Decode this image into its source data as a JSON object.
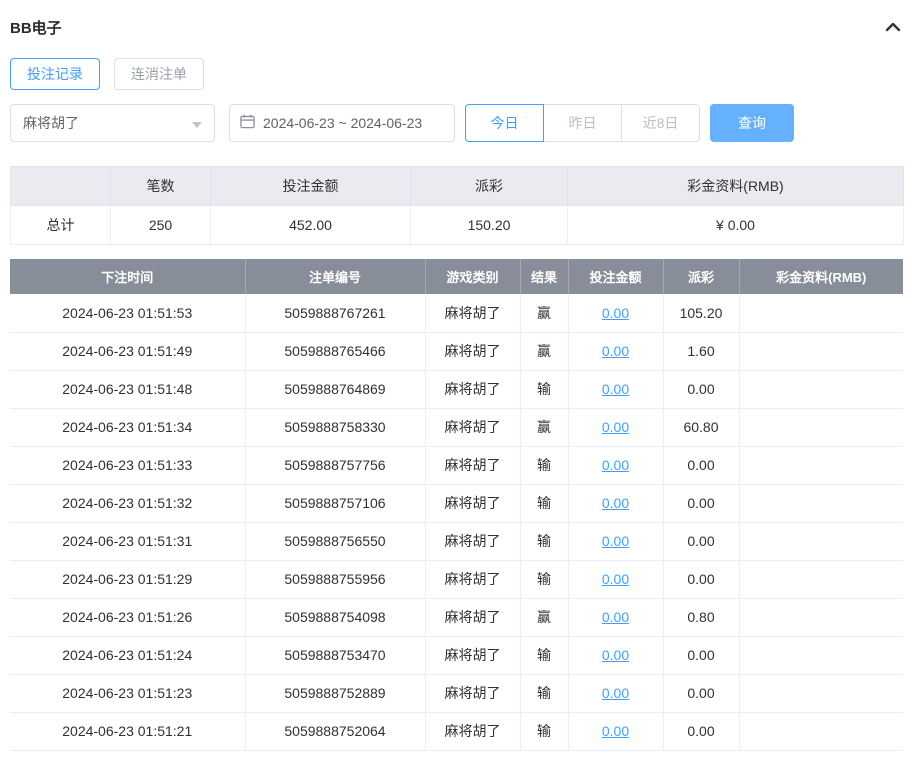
{
  "header": {
    "title": "BB电子"
  },
  "tabs": [
    {
      "label": "投注记录",
      "active": true
    },
    {
      "label": "连消注单",
      "active": false
    }
  ],
  "filters": {
    "game_select_value": "麻将胡了",
    "date_range_value": "2024-06-23 ~ 2024-06-23",
    "quick_buttons": [
      {
        "label": "今日",
        "active": true
      },
      {
        "label": "昨日",
        "active": false
      },
      {
        "label": "近8日",
        "active": false
      }
    ],
    "search_label": "查询"
  },
  "summary": {
    "headers": [
      "",
      "笔数",
      "投注金额",
      "派彩",
      "彩金资料(RMB)"
    ],
    "row": {
      "label": "总计",
      "count": "250",
      "bet": "452.00",
      "payout": "150.20",
      "bonus": "¥ 0.00"
    }
  },
  "table": {
    "headers": [
      "下注时间",
      "注单编号",
      "游戏类别",
      "结果",
      "投注金额",
      "派彩",
      "彩金资料(RMB)"
    ],
    "rows": [
      {
        "time": "2024-06-23 01:51:53",
        "id": "5059888767261",
        "game": "麻将胡了",
        "result": "赢",
        "bet": "0.00",
        "payout": "105.20",
        "bonus": ""
      },
      {
        "time": "2024-06-23 01:51:49",
        "id": "5059888765466",
        "game": "麻将胡了",
        "result": "赢",
        "bet": "0.00",
        "payout": "1.60",
        "bonus": ""
      },
      {
        "time": "2024-06-23 01:51:48",
        "id": "5059888764869",
        "game": "麻将胡了",
        "result": "输",
        "bet": "0.00",
        "payout": "0.00",
        "bonus": ""
      },
      {
        "time": "2024-06-23 01:51:34",
        "id": "5059888758330",
        "game": "麻将胡了",
        "result": "赢",
        "bet": "0.00",
        "payout": "60.80",
        "bonus": ""
      },
      {
        "time": "2024-06-23 01:51:33",
        "id": "5059888757756",
        "game": "麻将胡了",
        "result": "输",
        "bet": "0.00",
        "payout": "0.00",
        "bonus": ""
      },
      {
        "time": "2024-06-23 01:51:32",
        "id": "5059888757106",
        "game": "麻将胡了",
        "result": "输",
        "bet": "0.00",
        "payout": "0.00",
        "bonus": ""
      },
      {
        "time": "2024-06-23 01:51:31",
        "id": "5059888756550",
        "game": "麻将胡了",
        "result": "输",
        "bet": "0.00",
        "payout": "0.00",
        "bonus": ""
      },
      {
        "time": "2024-06-23 01:51:29",
        "id": "5059888755956",
        "game": "麻将胡了",
        "result": "输",
        "bet": "0.00",
        "payout": "0.00",
        "bonus": ""
      },
      {
        "time": "2024-06-23 01:51:26",
        "id": "5059888754098",
        "game": "麻将胡了",
        "result": "赢",
        "bet": "0.00",
        "payout": "0.80",
        "bonus": ""
      },
      {
        "time": "2024-06-23 01:51:24",
        "id": "5059888753470",
        "game": "麻将胡了",
        "result": "输",
        "bet": "0.00",
        "payout": "0.00",
        "bonus": ""
      },
      {
        "time": "2024-06-23 01:51:23",
        "id": "5059888752889",
        "game": "麻将胡了",
        "result": "输",
        "bet": "0.00",
        "payout": "0.00",
        "bonus": ""
      },
      {
        "time": "2024-06-23 01:51:21",
        "id": "5059888752064",
        "game": "麻将胡了",
        "result": "输",
        "bet": "0.00",
        "payout": "0.00",
        "bonus": ""
      }
    ]
  },
  "colors": {
    "accent": "#409eff",
    "search-btn": "#66b1ff",
    "table-header-bg": "#878d99",
    "summary-header-bg": "#e9ebf0"
  }
}
